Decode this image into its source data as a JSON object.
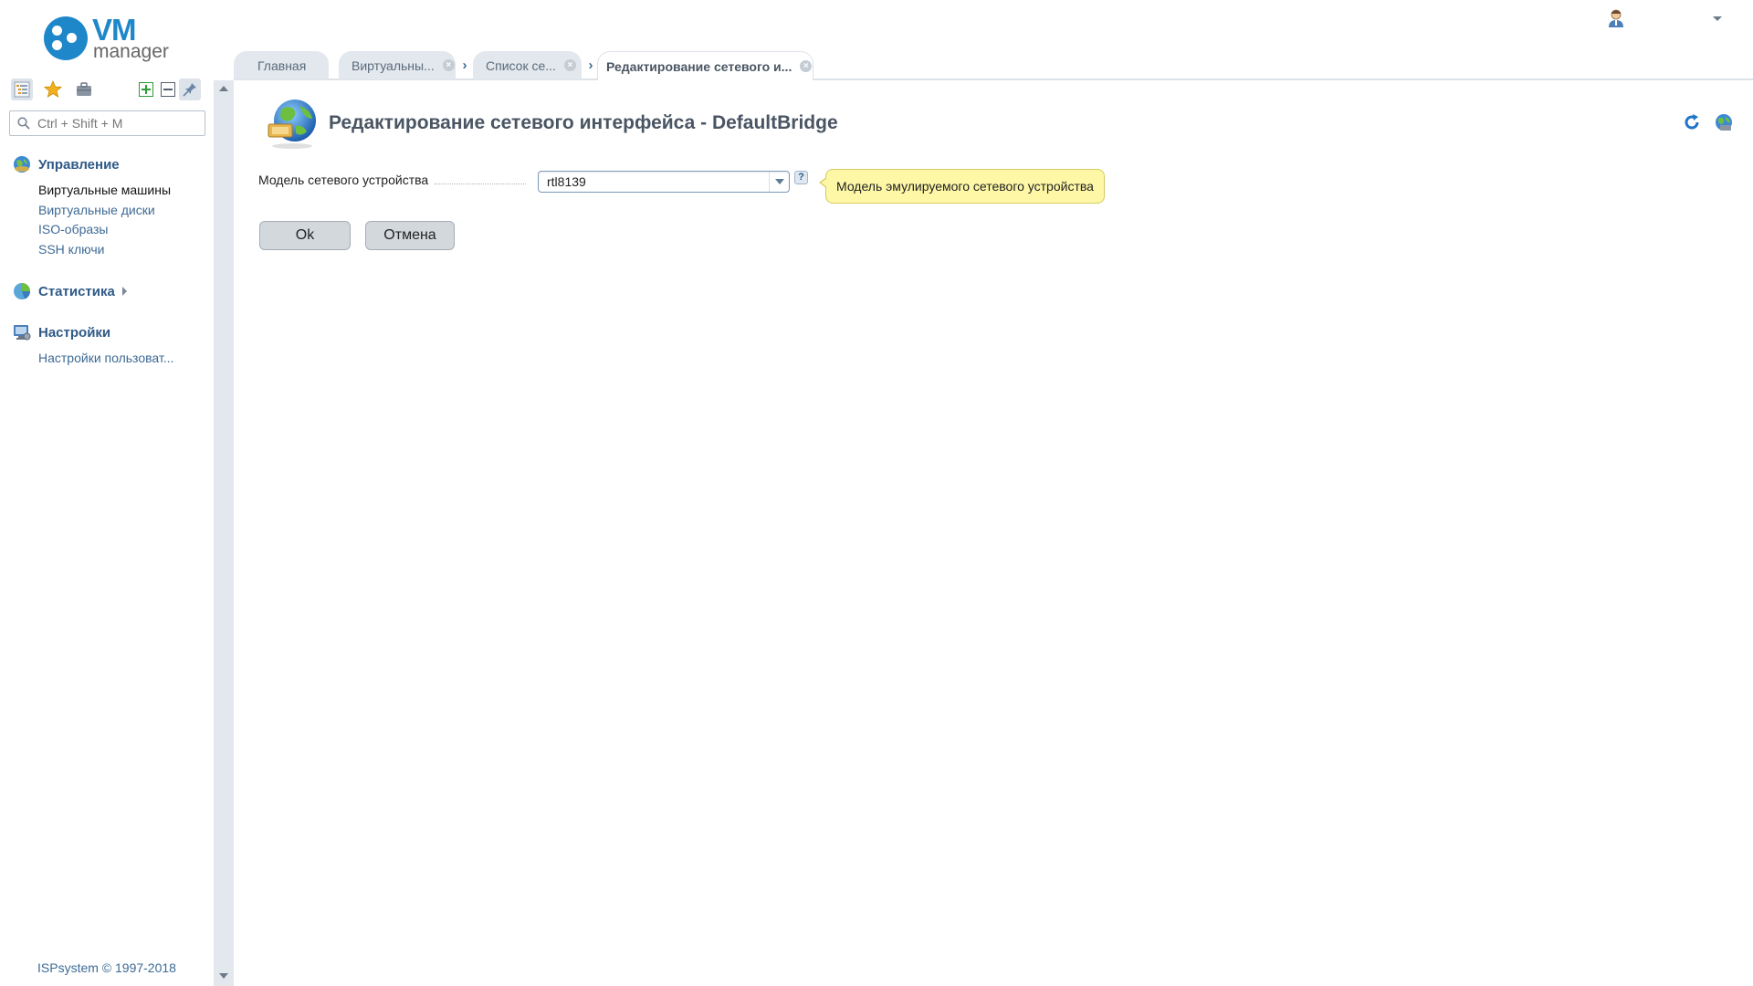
{
  "brand": {
    "logo_main": "VM",
    "logo_sub": "manager",
    "accent": "#1e87c9"
  },
  "sidebar": {
    "toolbar": [
      "menu-tree-icon",
      "favorites-star-icon",
      "briefcase-icon",
      "expand-all-icon",
      "collapse-all-icon",
      "pin-icon"
    ],
    "search": {
      "placeholder": "Ctrl + Shift + M"
    },
    "groups": [
      {
        "title": "Управление",
        "icon": "globe-icon",
        "items": [
          "Виртуальные машины",
          "Виртуальные диски",
          "ISO-образы",
          "SSH ключи"
        ]
      },
      {
        "title": "Статистика",
        "icon": "chart-icon",
        "items": []
      },
      {
        "title": "Настройки",
        "icon": "settings-monitor-icon",
        "items": [
          "Настройки пользоват..."
        ]
      }
    ],
    "copyright": "ISPsystem © 1997-2018"
  },
  "tabs": [
    {
      "label": "Главная",
      "closable": false
    },
    {
      "label": "Виртуальны...",
      "closable": true
    },
    {
      "label": "Список се...",
      "closable": true
    },
    {
      "label": "Редактирование сетевого и...",
      "closable": true,
      "active": true
    }
  ],
  "page": {
    "title": "Редактирование сетевого интерфейса - DefaultBridge",
    "field": {
      "label": "Модель сетевого устройства",
      "value": "rtl8139",
      "help": "?",
      "hint": "Модель эмулируемого сетевого устройства"
    },
    "buttons": {
      "ok": "Ok",
      "cancel": "Отмена"
    }
  }
}
